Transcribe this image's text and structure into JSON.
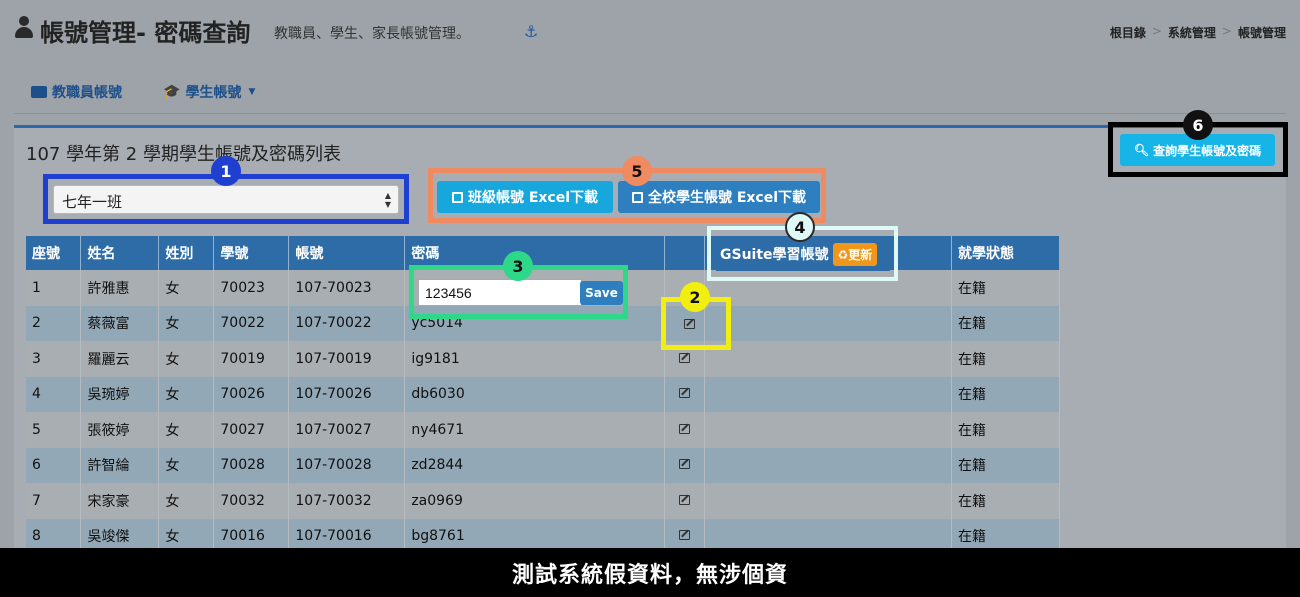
{
  "header": {
    "title": "帳號管理- 密碼查詢",
    "subtitle": "教職員、學生、家長帳號管理。",
    "breadcrumb": [
      "根目錄",
      "系統管理",
      "帳號管理"
    ],
    "breadcrumb_sep": ">"
  },
  "nav": {
    "staff_tab": "教職員帳號",
    "student_tab": "學生帳號"
  },
  "panel": {
    "title": "107 學年第 2 學期學生帳號及密碼列表",
    "class_select_value": "七年一班",
    "btn_class_excel": "班級帳號 Excel下載",
    "btn_school_excel": "全校學生帳號 Excel下載",
    "btn_query": "查詢學生帳號及密碼",
    "gsuite_label": "GSuite學習帳號",
    "gsuite_update": "更新"
  },
  "badges": [
    "1",
    "2",
    "3",
    "4",
    "5",
    "6"
  ],
  "table": {
    "headers": [
      "座號",
      "姓名",
      "姓別",
      "學號",
      "帳號",
      "密碼",
      "",
      "",
      "就學狀態"
    ],
    "rows": [
      {
        "seat": "1",
        "name": "許雅惠",
        "gender": "女",
        "sid": "70023",
        "account": "107-70023",
        "password": "",
        "status": "在籍"
      },
      {
        "seat": "2",
        "name": "蔡薇富",
        "gender": "女",
        "sid": "70022",
        "account": "107-70022",
        "password": "yc5014",
        "status": "在籍"
      },
      {
        "seat": "3",
        "name": "羅麗云",
        "gender": "女",
        "sid": "70019",
        "account": "107-70019",
        "password": "ig9181",
        "status": "在籍"
      },
      {
        "seat": "4",
        "name": "吳琬婷",
        "gender": "女",
        "sid": "70026",
        "account": "107-70026",
        "password": "db6030",
        "status": "在籍"
      },
      {
        "seat": "5",
        "name": "張筱婷",
        "gender": "女",
        "sid": "70027",
        "account": "107-70027",
        "password": "ny4671",
        "status": "在籍"
      },
      {
        "seat": "6",
        "name": "許智綸",
        "gender": "女",
        "sid": "70028",
        "account": "107-70028",
        "password": "zd2844",
        "status": "在籍"
      },
      {
        "seat": "7",
        "name": "宋家豪",
        "gender": "女",
        "sid": "70032",
        "account": "107-70032",
        "password": "za0969",
        "status": "在籍"
      },
      {
        "seat": "8",
        "name": "吳竣傑",
        "gender": "女",
        "sid": "70016",
        "account": "107-70016",
        "password": "bg8761",
        "status": "在籍"
      }
    ]
  },
  "password_edit": {
    "value": "123456",
    "save_label": "Save"
  },
  "footer": "測試系統假資料，無涉個資"
}
